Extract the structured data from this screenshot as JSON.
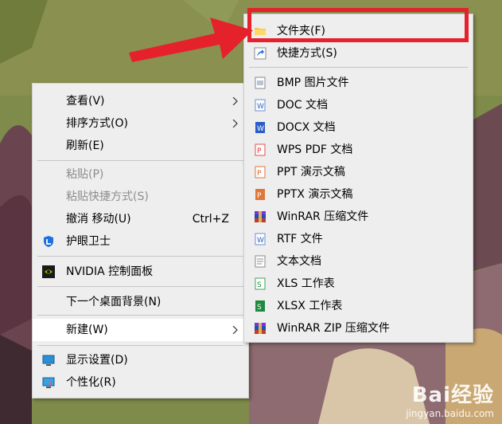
{
  "context_menu": {
    "items": [
      {
        "label": "查看(V)"
      },
      {
        "label": "排序方式(O)"
      },
      {
        "label": "刷新(E)"
      },
      {
        "label": "粘贴(P)"
      },
      {
        "label": "粘贴快捷方式(S)"
      },
      {
        "label": "撤消 移动(U)",
        "shortcut": "Ctrl+Z"
      },
      {
        "label": "护眼卫士"
      },
      {
        "label": "NVIDIA 控制面板"
      },
      {
        "label": "下一个桌面背景(N)"
      },
      {
        "label": "新建(W)"
      },
      {
        "label": "显示设置(D)"
      },
      {
        "label": "个性化(R)"
      }
    ]
  },
  "new_submenu": {
    "items": [
      {
        "label": "文件夹(F)"
      },
      {
        "label": "快捷方式(S)"
      },
      {
        "label": "BMP 图片文件"
      },
      {
        "label": "DOC 文档"
      },
      {
        "label": "DOCX 文档"
      },
      {
        "label": "WPS PDF 文档"
      },
      {
        "label": "PPT 演示文稿"
      },
      {
        "label": "PPTX 演示文稿"
      },
      {
        "label": "WinRAR 压缩文件"
      },
      {
        "label": "RTF 文件"
      },
      {
        "label": "文本文档"
      },
      {
        "label": "XLS 工作表"
      },
      {
        "label": "XLSX 工作表"
      },
      {
        "label": "WinRAR ZIP 压缩文件"
      }
    ]
  },
  "watermark": {
    "brand": "Bai经验",
    "url": "jingyan.baidu.com"
  },
  "colors": {
    "annotation_red": "#e5212b",
    "menu_bg": "#eeeeee"
  }
}
